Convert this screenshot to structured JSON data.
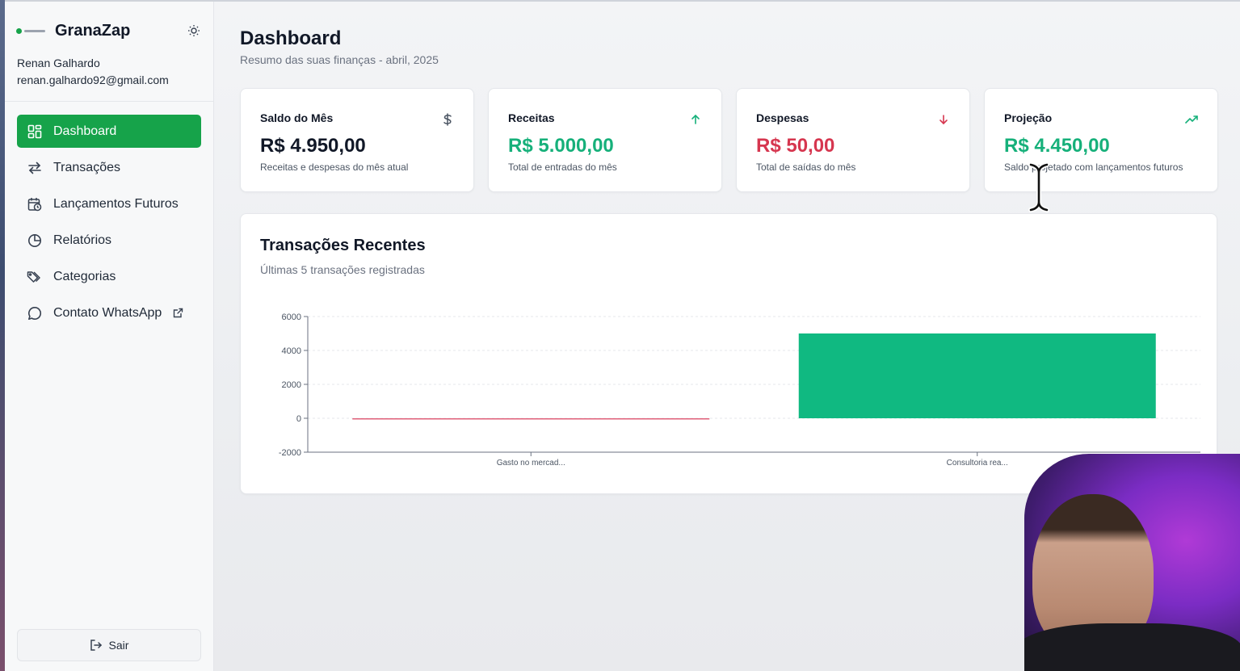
{
  "sidebar": {
    "brand": "GranaZap",
    "user": {
      "name": "Renan Galhardo",
      "email": "renan.galhardo92@gmail.com"
    },
    "items": [
      {
        "label": "Dashboard",
        "icon": "grid-icon",
        "active": true
      },
      {
        "label": "Transações",
        "icon": "arrows-swap-icon"
      },
      {
        "label": "Lançamentos Futuros",
        "icon": "calendar-clock-icon"
      },
      {
        "label": "Relatórios",
        "icon": "pie-chart-icon"
      },
      {
        "label": "Categorias",
        "icon": "tags-icon"
      },
      {
        "label": "Contato WhatsApp",
        "icon": "chat-bubble-icon",
        "external": true
      }
    ],
    "logout_label": "Sair"
  },
  "header": {
    "title": "Dashboard",
    "subtitle": "Resumo das suas finanças - abril, 2025"
  },
  "cards": [
    {
      "title": "Saldo do Mês",
      "value": "R$ 4.950,00",
      "description": "Receitas e despesas do mês atual",
      "icon": "dollar-icon",
      "color": "#111827"
    },
    {
      "title": "Receitas",
      "value": "R$ 5.000,00",
      "description": "Total de entradas do mês",
      "icon": "arrow-up-icon",
      "color": "#16b07a"
    },
    {
      "title": "Despesas",
      "value": "R$ 50,00",
      "description": "Total de saídas do mês",
      "icon": "arrow-down-icon",
      "color": "#d6364f"
    },
    {
      "title": "Projeção",
      "value": "R$ 4.450,00",
      "description": "Saldo projetado com lançamentos futuros",
      "icon": "trending-up-icon",
      "color": "#16b07a"
    }
  ],
  "recent": {
    "title": "Transações Recentes",
    "subtitle": "Últimas 5 transações registradas"
  },
  "chart_data": {
    "type": "bar",
    "categories": [
      "Gasto no mercad...",
      "Consultoria rea..."
    ],
    "values": [
      -50,
      5000
    ],
    "colors": [
      "#e0607a",
      "#10b981"
    ],
    "ylim": [
      -2000,
      6000
    ],
    "yticks": [
      -2000,
      0,
      2000,
      4000,
      6000
    ],
    "grid": true,
    "title": "",
    "xlabel": "",
    "ylabel": ""
  },
  "colors": {
    "accent": "#16a34a",
    "income": "#16b07a",
    "expense": "#d6364f"
  }
}
